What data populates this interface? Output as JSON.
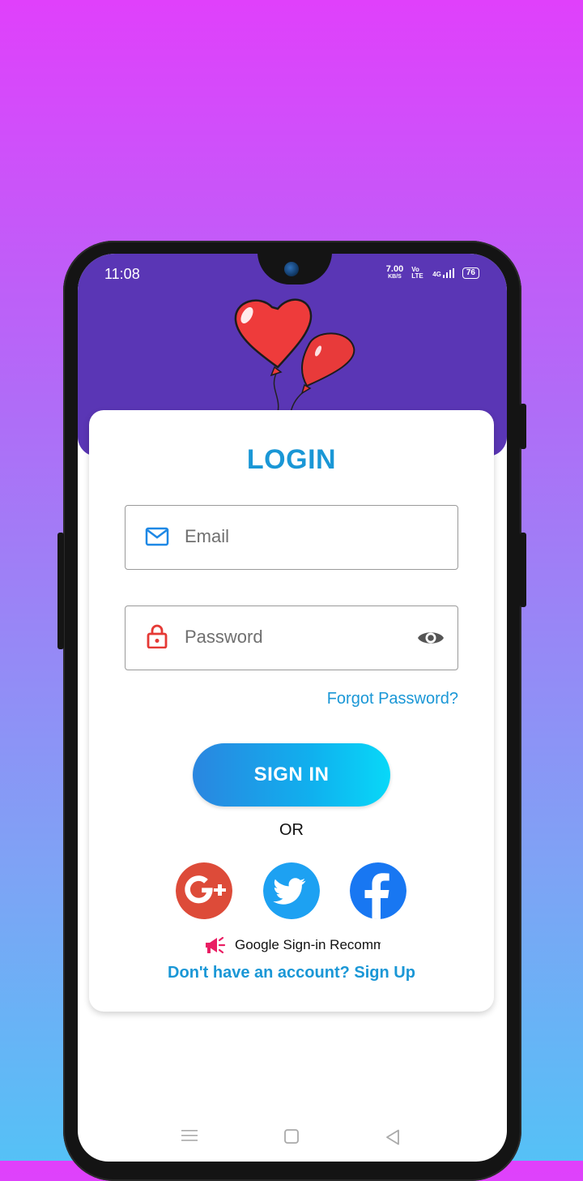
{
  "status_bar": {
    "time": "11:08",
    "net_speed_value": "7.00",
    "net_speed_unit": "KB/S",
    "volte": "Vo LTE",
    "network": "4G",
    "battery": "76"
  },
  "header": {
    "illustration": "heart-balloons"
  },
  "login": {
    "title": "LOGIN",
    "email_placeholder": "Email",
    "password_placeholder": "Password",
    "forgot_password": "Forgot Password?",
    "sign_in_button": "SIGN IN",
    "or_text": "OR",
    "recommendation_text": "Google Sign-in Recommended",
    "signup_prompt": "Don't have an account? Sign Up"
  },
  "social": [
    {
      "name": "google-plus",
      "color": "#dd4b39"
    },
    {
      "name": "twitter",
      "color": "#1da1f2"
    },
    {
      "name": "facebook",
      "color": "#1877f2"
    }
  ],
  "colors": {
    "header": "#5a36b5",
    "accent": "#1a97d6",
    "button_gradient_start": "#2a86e0",
    "button_gradient_end": "#08d8f8",
    "lock_icon": "#e53935",
    "megaphone_icon": "#e91e63"
  },
  "navigation": [
    "menu-icon",
    "home-icon",
    "back-icon"
  ]
}
